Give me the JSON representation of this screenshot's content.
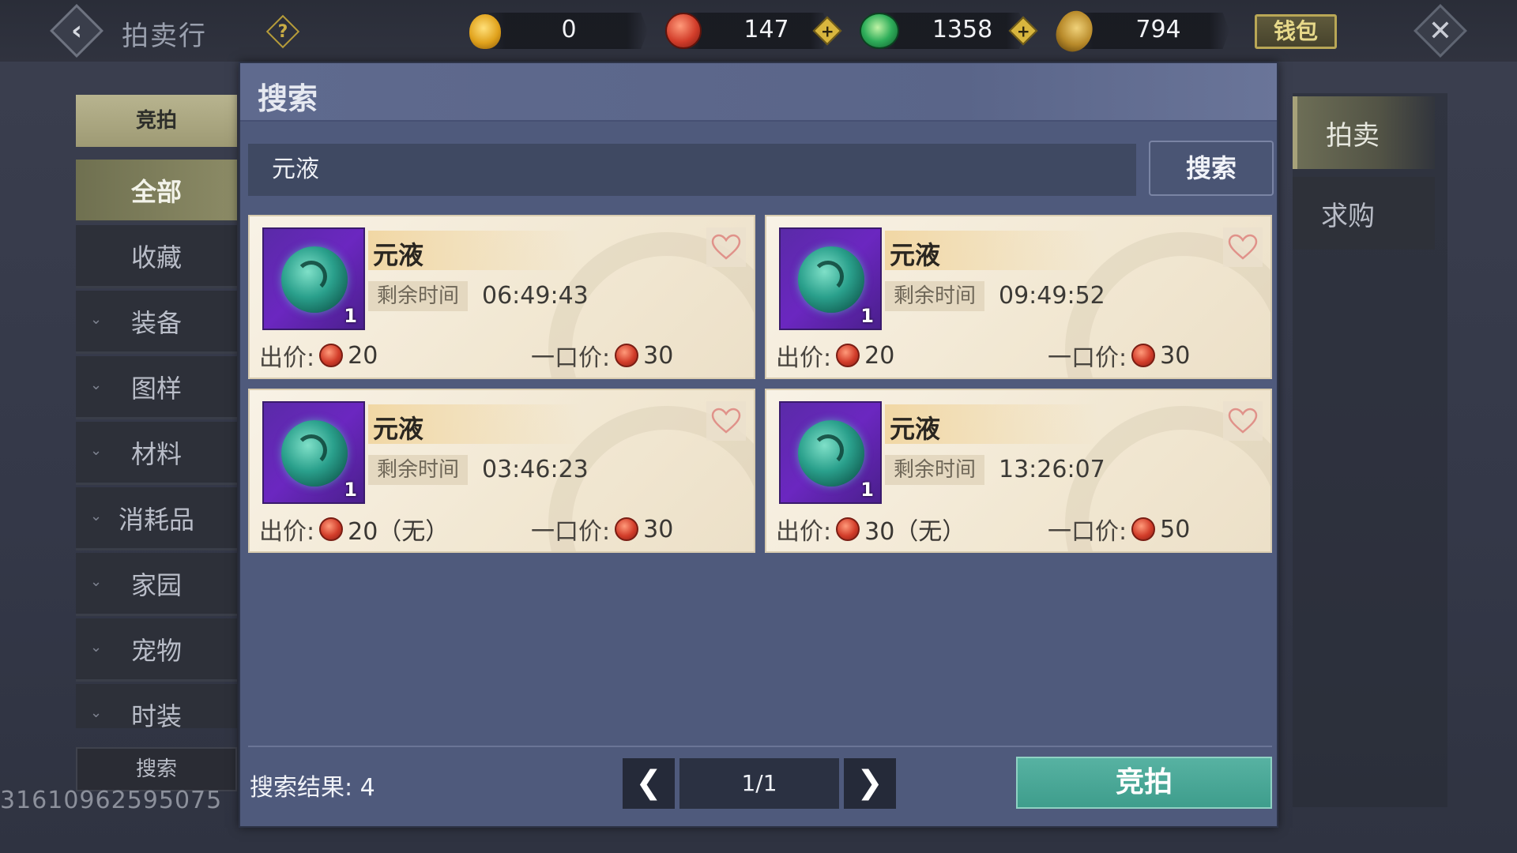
{
  "header": {
    "title": "拍卖行",
    "currencies": [
      {
        "name": "gold-coin",
        "value": "0"
      },
      {
        "name": "red-jade",
        "value": "147"
      },
      {
        "name": "green-jade",
        "value": "1358"
      },
      {
        "name": "shell-coin",
        "value": "794"
      }
    ],
    "wallet_label": "钱包"
  },
  "sidebar": {
    "header": "竞拍",
    "items": [
      {
        "label": "全部",
        "active": true,
        "expandable": false
      },
      {
        "label": "收藏",
        "active": false,
        "expandable": false
      },
      {
        "label": "装备",
        "active": false,
        "expandable": true
      },
      {
        "label": "图样",
        "active": false,
        "expandable": true
      },
      {
        "label": "材料",
        "active": false,
        "expandable": true
      },
      {
        "label": "消耗品",
        "active": false,
        "expandable": true
      },
      {
        "label": "家园",
        "active": false,
        "expandable": true
      },
      {
        "label": "宠物",
        "active": false,
        "expandable": true
      },
      {
        "label": "时装",
        "active": false,
        "expandable": true
      }
    ],
    "search_label": "搜索"
  },
  "user_id": "31610962595075",
  "right_tabs": [
    {
      "label": "拍卖",
      "active": true
    },
    {
      "label": "求购",
      "active": false
    }
  ],
  "panel": {
    "title": "搜索",
    "search_value": "元液",
    "search_button": "搜索",
    "listings": [
      {
        "name": "元液",
        "qty": "1",
        "time_label": "剩余时间",
        "time": "06:49:43",
        "bid_label": "出价:",
        "bid": "20",
        "buyout_label": "一口价:",
        "buyout": "30"
      },
      {
        "name": "元液",
        "qty": "1",
        "time_label": "剩余时间",
        "time": "09:49:52",
        "bid_label": "出价:",
        "bid": "20",
        "buyout_label": "一口价:",
        "buyout": "30"
      },
      {
        "name": "元液",
        "qty": "1",
        "time_label": "剩余时间",
        "time": "03:46:23",
        "bid_label": "出价:",
        "bid": "20（无）",
        "buyout_label": "一口价:",
        "buyout": "30"
      },
      {
        "name": "元液",
        "qty": "1",
        "time_label": "剩余时间",
        "time": "13:26:07",
        "bid_label": "出价:",
        "bid": "30（无）",
        "buyout_label": "一口价:",
        "buyout": "50"
      }
    ],
    "result_label": "搜索结果:",
    "result_count": "4",
    "page": "1/1",
    "bid_button": "竞拍"
  }
}
